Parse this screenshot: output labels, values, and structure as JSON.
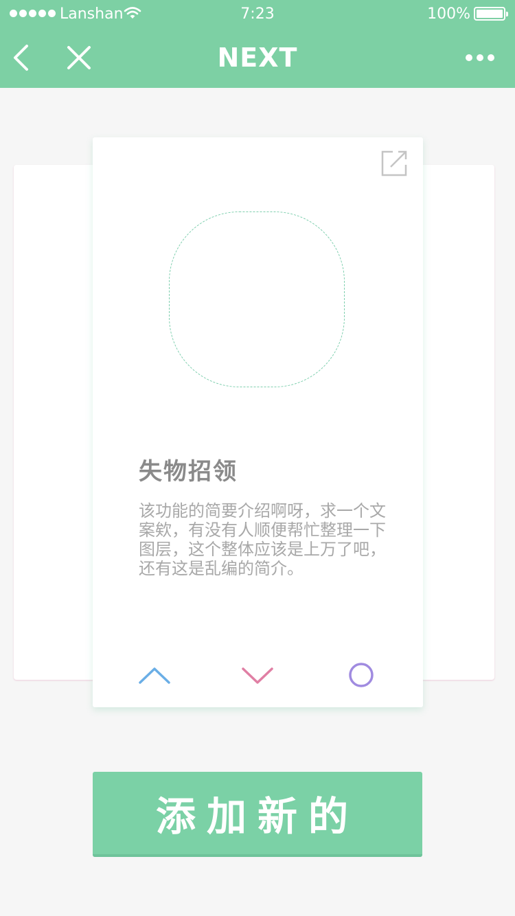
{
  "status_bar": {
    "carrier": "Lanshan",
    "time": "7:23",
    "battery": "100%"
  },
  "nav": {
    "title": "NEXT",
    "back_icon": "chevron-left-icon",
    "close_icon": "close-icon",
    "more_icon": "more-dots-icon"
  },
  "card": {
    "title": "失物招领",
    "description": "该功能的简要介绍啊呀，求一个文案欸，有没有人顺便帮忙整理一下图层，这个整体应该是上万了吧，还有这是乱编的简介。",
    "actions": [
      {
        "icon": "chevron-up-icon",
        "color": "#6aaee6"
      },
      {
        "icon": "chevron-down-icon",
        "color": "#e07fa4"
      },
      {
        "icon": "circle-icon",
        "color": "#a08be0"
      }
    ]
  },
  "add_button": {
    "label": "添加新的"
  },
  "colors": {
    "brand": "#7dd0a4",
    "background": "#f6f6f6"
  }
}
